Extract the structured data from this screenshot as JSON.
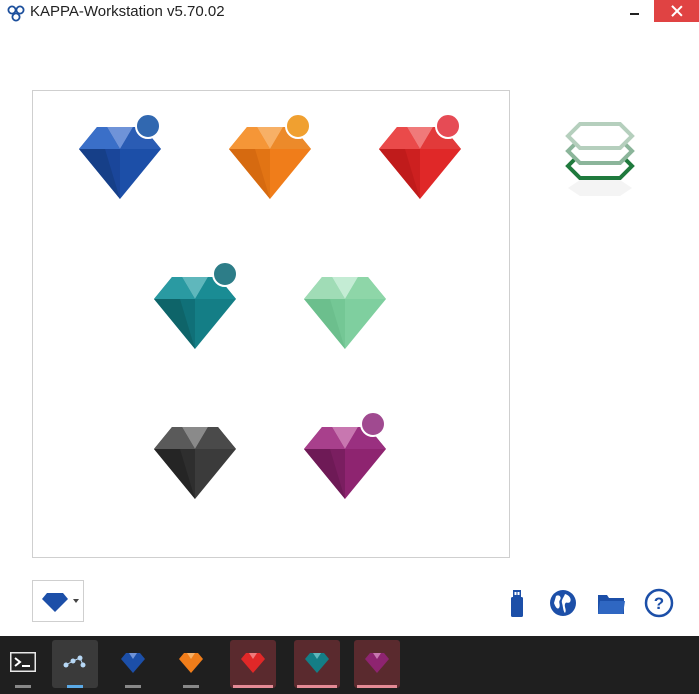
{
  "window": {
    "title": "KAPPA-Workstation v5.70.02"
  },
  "colors": {
    "close_button": "#e04343",
    "blue_gem": "#1c4fa8",
    "orange_gem": "#f07d1a",
    "red_gem": "#e02828",
    "teal_gem": "#147e86",
    "mint_gem": "#7fcf9f",
    "black_gem": "#3b3b3b",
    "purple_gem": "#8e2470",
    "stack_green": "#1f7a3d",
    "taskbar": "#1f1f1f"
  },
  "gems": [
    {
      "name": "blue-gem",
      "color": "#1c4fa8",
      "has_badge": true
    },
    {
      "name": "orange-gem",
      "color": "#f07d1a",
      "has_badge": true
    },
    {
      "name": "red-gem",
      "color": "#e02828",
      "has_badge": true
    },
    {
      "name": "teal-gem",
      "color": "#147e86",
      "has_badge": true
    },
    {
      "name": "mint-gem",
      "color": "#7fcf9f",
      "has_badge": false
    },
    {
      "name": "black-gem",
      "color": "#3b3b3b",
      "has_badge": false
    },
    {
      "name": "purple-gem",
      "color": "#8e2470",
      "has_badge": true
    }
  ],
  "toolbar": {
    "dropdown_icon": "gem-icon",
    "tools": [
      "usb-icon",
      "globe-icon",
      "folder-icon",
      "help-icon"
    ]
  },
  "taskbar": {
    "items": [
      "terminal-icon",
      "network-icon",
      "blue-gem-icon",
      "orange-gem-icon",
      "red-gem-icon",
      "teal-gem-icon",
      "purple-gem-icon"
    ]
  }
}
